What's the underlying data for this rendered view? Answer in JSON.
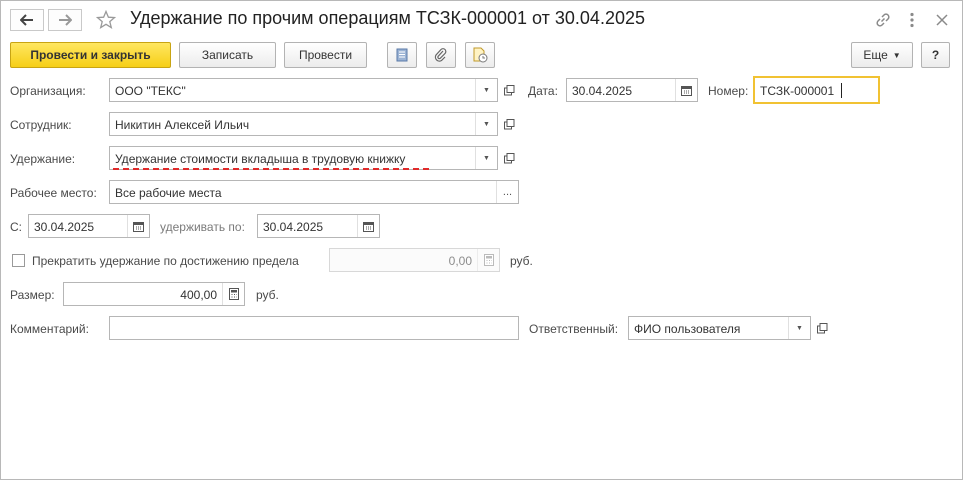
{
  "window": {
    "title": "Удержание по прочим операциям ТСЗК-000001 от 30.04.2025"
  },
  "toolbar": {
    "post_and_close": "Провести и закрыть",
    "save": "Записать",
    "post": "Провести",
    "more": "Еще",
    "help": "?"
  },
  "form": {
    "organization": {
      "label": "Организация:",
      "value": "ООО \"ТЕКС\""
    },
    "date": {
      "label": "Дата:",
      "value": "30.04.2025"
    },
    "number": {
      "label": "Номер:",
      "value": "ТСЗК-000001"
    },
    "employee": {
      "label": "Сотрудник:",
      "value": "Никитин Алексей Ильич"
    },
    "deduction": {
      "label": "Удержание:",
      "value": "Удержание стоимости вкладыша в трудовую книжку"
    },
    "workplace": {
      "label": "Рабочее место:",
      "value": "Все рабочие места"
    },
    "from": {
      "label": "С:",
      "value": "30.04.2025"
    },
    "to": {
      "label": "удерживать по:",
      "value": "30.04.2025"
    },
    "stop_limit": {
      "label": "Прекратить удержание по достижению предела",
      "checked": false,
      "value": "0,00",
      "currency": "руб."
    },
    "size": {
      "label": "Размер:",
      "value": "400,00",
      "currency": "руб."
    },
    "comment": {
      "label": "Комментарий:",
      "value": ""
    },
    "responsible": {
      "label": "Ответственный:",
      "value": "ФИО пользователя"
    }
  }
}
